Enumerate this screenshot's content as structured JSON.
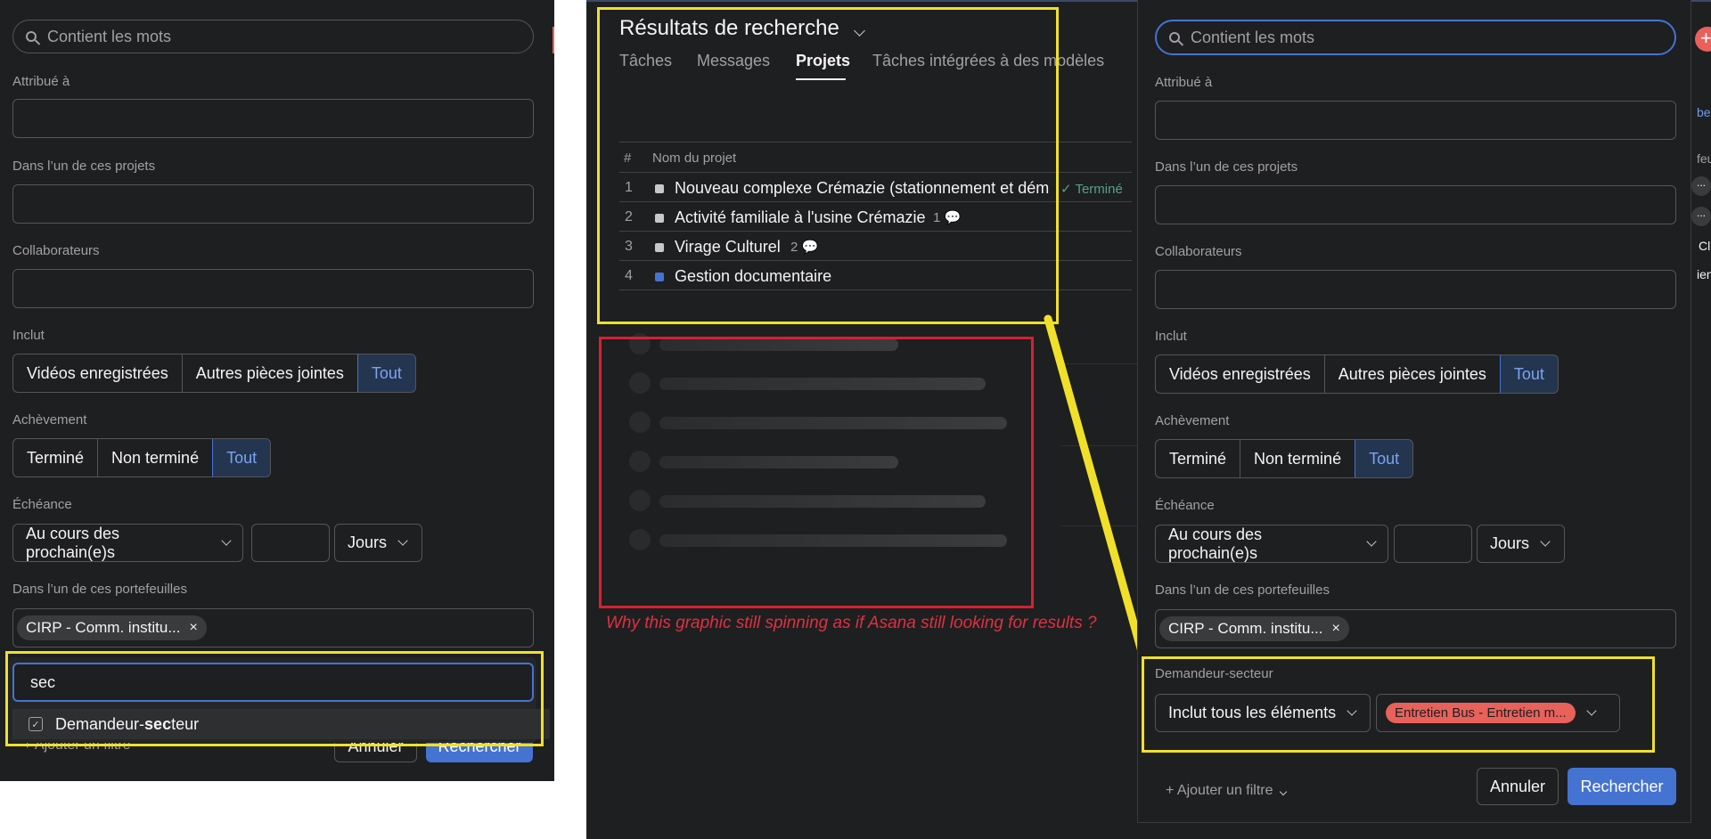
{
  "left_panel": {
    "search_placeholder": "Contient les mots",
    "assigned_label": "Attribué à",
    "projects_label": "Dans l’un de ces projets",
    "collaborators_label": "Collaborateurs",
    "includes_label": "Inclut",
    "includes_options": [
      "Vidéos enregistrées",
      "Autres pièces jointes",
      "Tout"
    ],
    "completion_label": "Achèvement",
    "completion_options": [
      "Terminé",
      "Non terminé",
      "Tout"
    ],
    "due_label": "Échéance",
    "due_select": "Au cours des prochain(e)s",
    "due_unit": "Jours",
    "portfolio_label": "Dans l’un de ces portefeuilles",
    "portfolio_chip": "CIRP - Comm. institu...",
    "chip_close": "×",
    "filter_input_value": "sec",
    "suggestion_prefix": "Demandeur-",
    "suggestion_match": "sec",
    "suggestion_suffix": "teur",
    "add_filter": "Ajouter un filtre",
    "cancel": "Annuler",
    "search_button": "Rechercher"
  },
  "results": {
    "title": "Résultats de recherche",
    "tabs": [
      "Tâches",
      "Messages",
      "Projets",
      "Tâches intégrées à des modèles"
    ],
    "active_tab": "Projets",
    "col_num": "#",
    "col_name": "Nom du projet",
    "rows": [
      {
        "num": "1",
        "name": "Nouveau complexe Crémazie (stationnement et démé",
        "status": "✓ Terminé",
        "comments": "",
        "color": "#c9c8c9"
      },
      {
        "num": "2",
        "name": "Activité familiale à l'usine Crémazie",
        "status": "",
        "comments": "1",
        "color": "#c9c8c9"
      },
      {
        "num": "3",
        "name": "Virage Culturel",
        "status": "",
        "comments": "2",
        "color": "#c9c8c9"
      },
      {
        "num": "4",
        "name": "Gestion documentaire",
        "status": "",
        "comments": "",
        "color": "#4573d2"
      }
    ],
    "annotation": "Why this graphic still spinning as if Asana still looking for results ?"
  },
  "right_panel": {
    "search_placeholder": "Contient les mots",
    "assigned_label": "Attribué à",
    "projects_label": "Dans l’un de ces projets",
    "collaborators_label": "Collaborateurs",
    "includes_label": "Inclut",
    "includes_options": [
      "Vidéos enregistrées",
      "Autres pièces jointes",
      "Tout"
    ],
    "completion_label": "Achèvement",
    "completion_options": [
      "Terminé",
      "Non terminé",
      "Tout"
    ],
    "due_label": "Échéance",
    "due_select": "Au cours des prochain(e)s",
    "due_unit": "Jours",
    "portfolio_label": "Dans l’un de ces portefeuilles",
    "portfolio_chip": "CIRP - Comm. institu...",
    "chip_close": "×",
    "custom_field_label": "Demandeur-secteur",
    "custom_field_mode": "Inclut tous les éléments",
    "custom_field_value": "Entretien Bus - Entretien m...",
    "add_filter": "Ajouter un filtre",
    "cancel": "Annuler",
    "search_button": "Rechercher"
  },
  "edge_fragments": [
    "Cl",
    "ien",
    "feu",
    "ber",
    "..."
  ],
  "colors": {
    "panel_bg": "#1e1f21",
    "accent_blue": "#4573d2",
    "highlight_yellow": "#f0e02a",
    "annotation_red": "#d91f32",
    "tag_red": "#e8615b"
  }
}
